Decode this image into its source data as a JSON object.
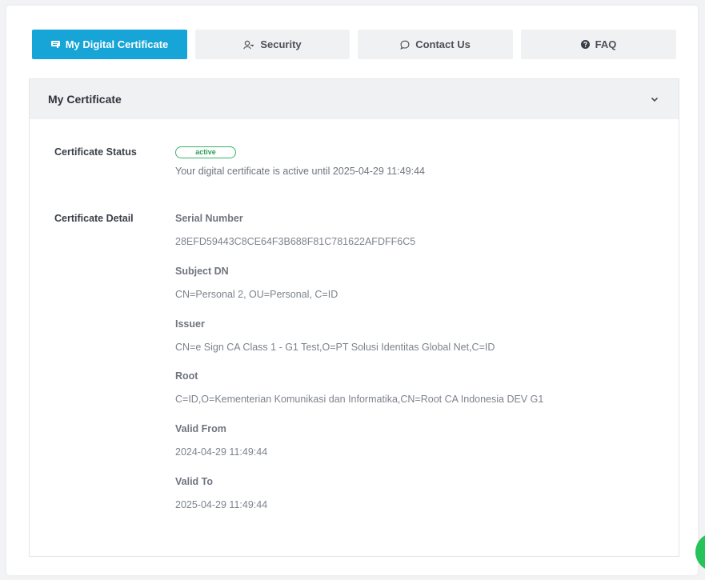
{
  "tabs": [
    {
      "label": "My Digital Certificate",
      "icon": "certificate-icon",
      "active": true
    },
    {
      "label": "Security",
      "icon": "user-key-icon",
      "active": false
    },
    {
      "label": "Contact Us",
      "icon": "chat-bubble-icon",
      "active": false
    },
    {
      "label": "FAQ",
      "icon": "help-circle-icon",
      "active": false
    }
  ],
  "panel": {
    "title": "My Certificate",
    "toggle_icon": "chevron-down-icon"
  },
  "status": {
    "label": "Certificate Status",
    "badge": "active",
    "text": "Your digital certificate is active until 2025-04-29 11:49:44"
  },
  "detail": {
    "label": "Certificate Detail",
    "items": [
      {
        "title": "Serial Number",
        "value": "28EFD59443C8CE64F3B688F81C781622AFDFF6C5"
      },
      {
        "title": "Subject DN",
        "value": "CN=Personal 2, OU=Personal, C=ID"
      },
      {
        "title": "Issuer",
        "value": "CN=e Sign CA Class 1 - G1 Test,O=PT Solusi Identitas Global Net,C=ID"
      },
      {
        "title": "Root",
        "value": "C=ID,O=Kementerian Komunikasi dan Informatika,CN=Root CA Indonesia DEV G1"
      },
      {
        "title": "Valid From",
        "value": "2024-04-29 11:49:44"
      },
      {
        "title": "Valid To",
        "value": "2025-04-29 11:49:44"
      }
    ]
  },
  "colors": {
    "accent": "#17a4d6",
    "status_green": "#2e9d5d",
    "chat_button": "#27c25a"
  }
}
